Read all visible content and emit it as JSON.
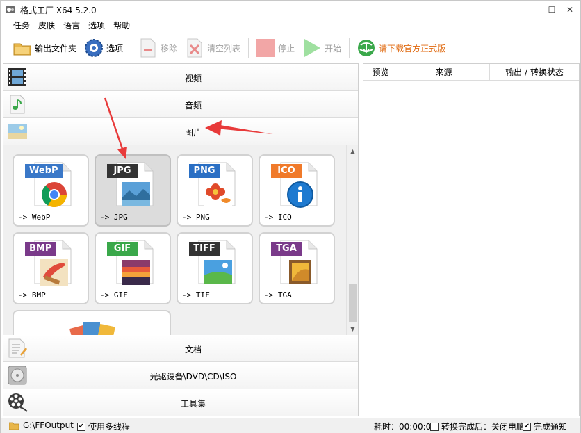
{
  "window": {
    "title": "格式工厂 X64 5.2.0",
    "minimize": "–",
    "maximize": "☐",
    "close": "✕"
  },
  "menu": [
    "任务",
    "皮肤",
    "语言",
    "选项",
    "帮助"
  ],
  "toolbar": {
    "output_folder": "输出文件夹",
    "options": "选项",
    "remove": "移除",
    "clear_list": "清空列表",
    "stop": "停止",
    "start": "开始",
    "download": "请下载官方正式版"
  },
  "categories": {
    "video": "视频",
    "audio": "音频",
    "image": "图片",
    "document": "文档",
    "optical": "光驱设备\\DVD\\CD\\ISO",
    "tools": "工具集"
  },
  "formats": [
    {
      "tag": "WebP",
      "out": "-> WebP",
      "color": "#3a78c8",
      "icon": "chrome-icon"
    },
    {
      "tag": "JPG",
      "out": "-> JPG",
      "color": "#333333",
      "icon": "landscape-icon"
    },
    {
      "tag": "PNG",
      "out": "-> PNG",
      "color": "#2a6fc4",
      "icon": "flower-icon"
    },
    {
      "tag": "ICO",
      "out": "-> ICO",
      "color": "#f07a2a",
      "icon": "info-icon"
    },
    {
      "tag": "BMP",
      "out": "-> BMP",
      "color": "#7a3a8a",
      "icon": "brush-icon"
    },
    {
      "tag": "GIF",
      "out": "-> GIF",
      "color": "#3aa84a",
      "icon": "sunset-icon"
    },
    {
      "tag": "TIFF",
      "out": "-> TIF",
      "color": "#333333",
      "icon": "landscape-icon"
    },
    {
      "tag": "TGA",
      "out": "-> TGA",
      "color": "#7a3a8a",
      "icon": "picture-icon"
    }
  ],
  "right_panel": {
    "col_preview": "预览",
    "col_source": "来源",
    "col_output": "输出 / 转换状态"
  },
  "status": {
    "output_path": "G:\\FFOutput",
    "multithread": "使用多线程",
    "time": "耗时：00:00:00",
    "after_convert": "转换完成后：关闭电脑",
    "notify": "完成通知",
    "multithread_checked": true,
    "after_convert_checked": false,
    "notify_checked": true
  },
  "selected_format": "JPG",
  "colors": {
    "promo": "#e06a10",
    "annotation_arrow": "#e83a3a"
  }
}
